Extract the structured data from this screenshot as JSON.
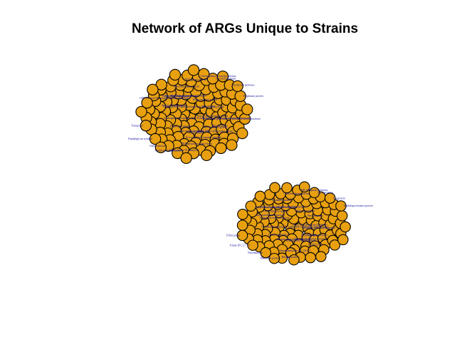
{
  "title": "Network of ARGs Unique to Strains",
  "colors": {
    "node_fill": "#e8a010",
    "node_stroke": "#000000",
    "edge": "#9ea0b8",
    "label": "#1010a0",
    "background": "#ffffff"
  },
  "graph": {
    "node_shape": "circle",
    "components": [
      {
        "name": "component-1",
        "node_count": 130,
        "labels": [
          "Bifunctional glucosamine-1-phosphate acetyltransferase",
          "Sensory histidine kinase",
          "Transcriptional regulator",
          "UDP-3-O-acyl-N-acetylglucosamine deacetylase",
          "Lipid A export ATP-binding protein",
          "Polymyxin resistance protein ArnC",
          "FIG00638284",
          "Multidrug resistance protein MdtK",
          "Outer membrane protein TolC",
          "Efflux transport system",
          "Putative phosphatase",
          "Hypothetical protein",
          "Undecaprenyl phosphate-alpha-4-amino-4-deoxy-L-arabinose arabinosyl transferase",
          "Tetracycline resistance protein",
          "Aminoglycoside phosphotransferase (EC 2.7.1.95)",
          "Beta-lactamase",
          "Penicillin-binding protein",
          "Two-component response regulator",
          "Macrolide export protein",
          "RNA polymerase sigma factor",
          "DNA gyrase subunit A",
          "Topoisomerase IV subunit B",
          "Chloramphenicol acetyltransferase",
          "Membrane fusion protein",
          "Glycosyltransferase",
          "Oxidoreductase",
          "Nucleoside permease",
          "Peptidoglycan synthase",
          "Periplasmic protein",
          "Transporter"
        ]
      },
      {
        "name": "component-2",
        "node_count": 120,
        "labels": [
          "Multidrug efflux system protein",
          "Outer membrane lipoprotein",
          "FIG00613342",
          "Transcriptional regulator",
          "Fosfomycin resistance protein",
          "Lipopolysaccharide biosynthesis protein",
          "UDP-glucose dehydrogenase",
          "Putative membrane protein",
          "Phosphoethanolamine transferase",
          "Response regulator",
          "Cystine transporter",
          "Beta-lactamase",
          "Non-phosphorylating glyceraldehyde-3-phosphate dehydrogenase",
          "Glycerol-3-phosphate transporter",
          "Polymyxin resistance protein",
          "Glycosyltransferase",
          "Sulfate permease",
          "FIG01213079",
          "Regulatory protein",
          "Aminotransferase (EC 2.6.1.-)",
          "Outer membrane protein",
          "Biofilm protein",
          "ABC transporter permease",
          "Membrane protein",
          "Acyltransferase",
          "Nitroreductase",
          "Lipoprotein",
          "Kinase (EC 2.7.7.-)",
          "Multidrug resistance protein",
          "Efflux pump"
        ]
      }
    ]
  }
}
